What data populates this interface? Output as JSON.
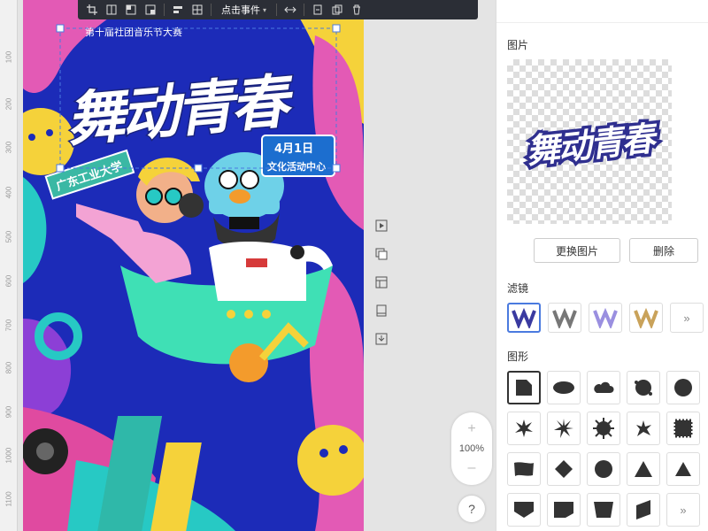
{
  "toolbar": {
    "click_event_label": "点击事件",
    "icons": [
      "crop-icon",
      "flip-icon",
      "layer-up-icon",
      "layer-down-icon",
      "align-icon",
      "grid-icon",
      "distribute-icon",
      "export-icon",
      "copy-icon",
      "trash-icon"
    ]
  },
  "ruler": {
    "ticks": [
      "100",
      "200",
      "300",
      "400",
      "500",
      "600",
      "700",
      "800",
      "900",
      "1000",
      "1100"
    ]
  },
  "poster": {
    "top_banner": "第十届社团音乐节大赛",
    "title": "舞动青春",
    "school": "广东工业大学",
    "date": "4月1日",
    "venue": "文化活动中心"
  },
  "side_tools": [
    "play-icon",
    "duplicate-icon",
    "layout-icon",
    "page-icon",
    "download-icon"
  ],
  "zoom": {
    "plus": "+",
    "level": "100%",
    "minus": "–"
  },
  "help": {
    "label": "?"
  },
  "panel": {
    "image_section_title": "图片",
    "thumbnail_text": "舞动青春",
    "replace_button": "更换图片",
    "delete_button": "删除",
    "filter_section_title": "滤镜",
    "filter_more": "»",
    "shape_section_title": "图形",
    "shape_more": "»"
  },
  "colors": {
    "accent_blue": "#4a7adf",
    "toolbar_bg": "#2b2e36",
    "poster_navy": "#1c2bb8",
    "poster_cyan": "#27c9c4",
    "poster_pink": "#e35ab5",
    "poster_yellow": "#f5d23a"
  }
}
